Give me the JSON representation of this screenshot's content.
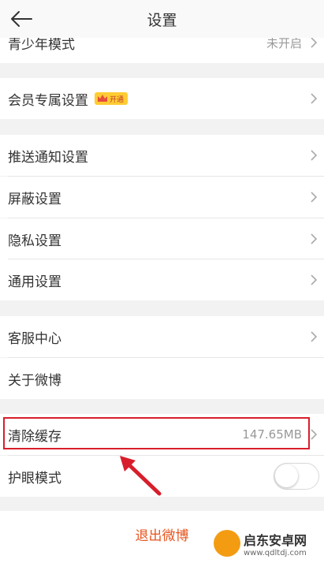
{
  "nav": {
    "title": "设置"
  },
  "groups": [
    {
      "items": [
        {
          "label": "青少年模式",
          "value": "未开启"
        }
      ]
    },
    {
      "items": [
        {
          "label": "会员专属设置",
          "badge": "开通"
        }
      ]
    },
    {
      "items": [
        {
          "label": "推送通知设置"
        },
        {
          "label": "屏蔽设置"
        },
        {
          "label": "隐私设置"
        },
        {
          "label": "通用设置"
        }
      ]
    },
    {
      "items": [
        {
          "label": "客服中心"
        },
        {
          "label": "关于微博"
        }
      ]
    },
    {
      "items": [
        {
          "label": "清除缓存",
          "value": "147.65MB"
        },
        {
          "label": "护眼模式",
          "toggle": false
        }
      ]
    }
  ],
  "logout": {
    "label": "退出微博"
  },
  "watermark": {
    "name": "启东安卓网",
    "url": "www.qdltdj.com"
  },
  "colors": {
    "accent": "#e8541e",
    "annotation": "#d81e2b"
  }
}
